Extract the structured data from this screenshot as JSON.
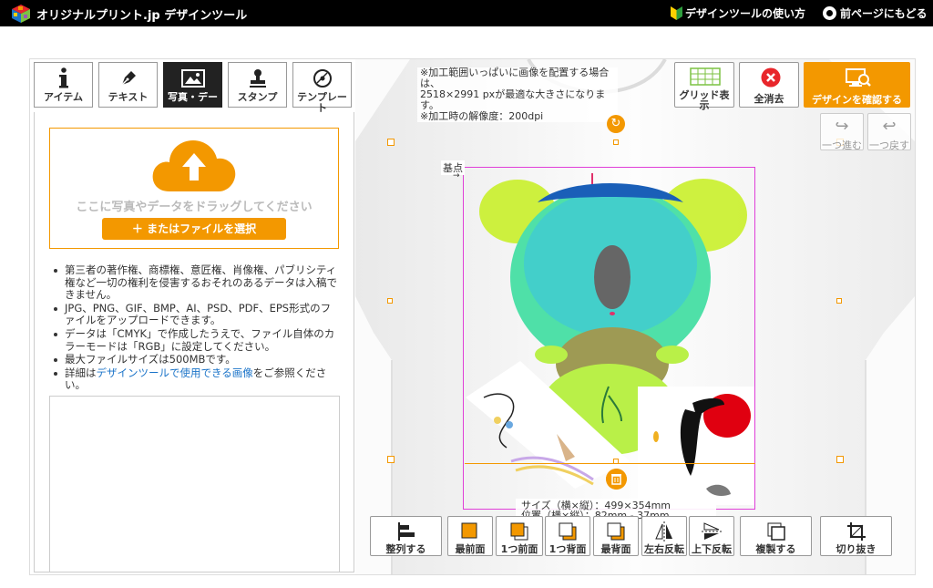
{
  "header": {
    "brand": "オリジナルプリント.jp デザインツール",
    "help_link": "デザインツールの使い方",
    "back_link": "前ページにもどる"
  },
  "tabs": [
    {
      "label": "アイテム",
      "icon": "info-icon",
      "active": false
    },
    {
      "label": "テキスト",
      "icon": "pen-icon",
      "active": false
    },
    {
      "label": "写真・デー",
      "icon": "image-icon",
      "active": true
    },
    {
      "label": "スタンプ",
      "icon": "stamp-icon",
      "active": false
    },
    {
      "label": "テンプレート",
      "icon": "template-icon",
      "active": false
    }
  ],
  "upload": {
    "drop_text": "ここに写真やデータをドラッグしてください",
    "select_button": "＋ またはファイルを選択"
  },
  "notes": [
    "第三者の著作権、商標権、意匠権、肖像権、パブリシティ権など一切の権利を侵害するおそれのあるデータは入稿できません。",
    "JPG、PNG、GIF、BMP、AI、PSD、PDF、EPS形式のファイルをアップロードできます。",
    "データは「CMYK」で作成したうえで、ファイル自体のカラーモードは「RGB」に設定してください。",
    "最大ファイルサイズは500MBです。"
  ],
  "notes_last": {
    "prefix": "詳細は",
    "link": "デザインツールで使用できる画像",
    "suffix": "をご参照ください。"
  },
  "canvas": {
    "info_line1": "※加工範囲いっぱいに画像を配置する場合は、",
    "info_line2": "2518×2991 pxが最適な大きさになります。",
    "info_line3": "※加工時の解像度：200dpi",
    "base_point": "基点",
    "size_line1": "サイズ（横×縦）：499×354mm",
    "size_line2": "位置（横×縦）：82mm - 37mm"
  },
  "toolbar": {
    "grid": "グリッド表示",
    "clear_all": "全消去",
    "confirm": "デザインを確認する",
    "redo": "一つ進む",
    "undo": "一つ戻す"
  },
  "bottom_toolbar": [
    {
      "label": "整列する",
      "icon": "align-icon"
    },
    {
      "label": "最前面",
      "icon": "bring-front-icon"
    },
    {
      "label": "1つ前面",
      "icon": "bring-forward-icon"
    },
    {
      "label": "1つ背面",
      "icon": "send-backward-icon"
    },
    {
      "label": "最背面",
      "icon": "send-back-icon"
    },
    {
      "label": "左右反転",
      "icon": "flip-horizontal-icon"
    },
    {
      "label": "上下反転",
      "icon": "flip-vertical-icon"
    },
    {
      "label": "複製する",
      "icon": "duplicate-icon"
    },
    {
      "label": "切り抜き",
      "icon": "crop-icon"
    }
  ],
  "colors": {
    "accent": "#f39800",
    "header_bg": "#000000",
    "print_area": "#e03fd8",
    "danger": "#e8262b"
  }
}
